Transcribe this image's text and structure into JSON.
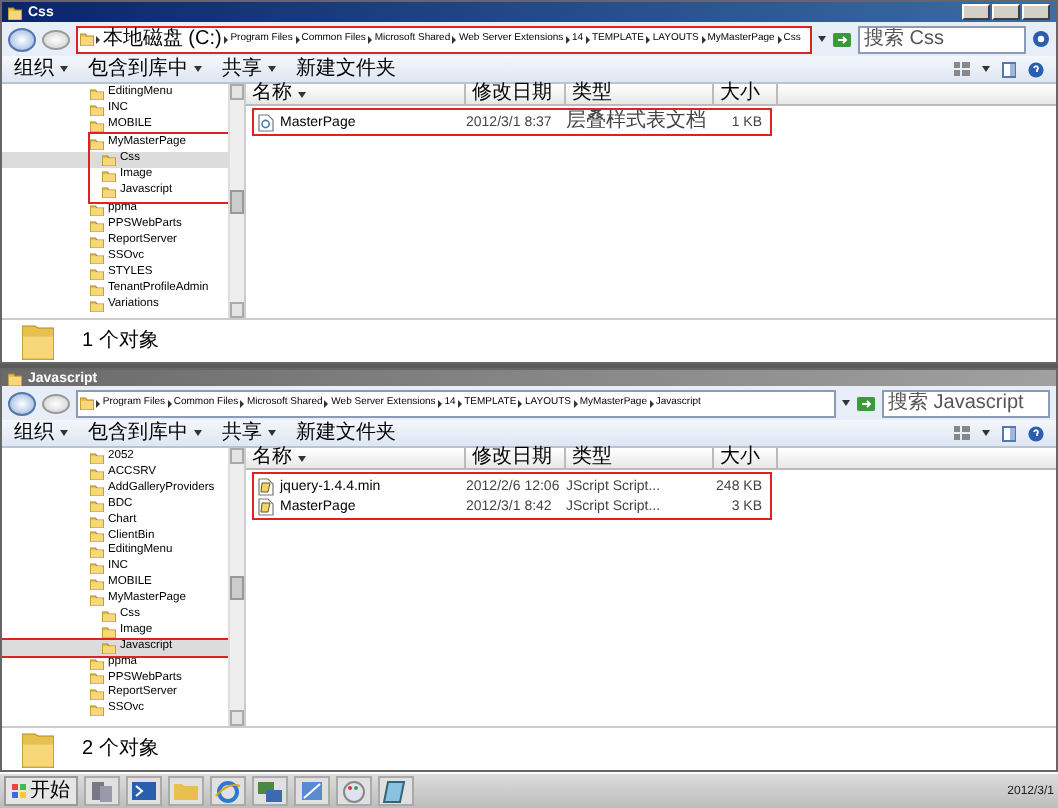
{
  "windows": [
    {
      "title": "Css",
      "caption_buttons": true,
      "address": {
        "highlighted": true,
        "crumbs": [
          "本地磁盘 (C:)",
          "Program Files",
          "Common Files",
          "Microsoft Shared",
          "Web Server Extensions",
          "14",
          "TEMPLATE",
          "LAYOUTS",
          "MyMasterPage",
          "Css"
        ]
      },
      "search": {
        "placeholder": "搜索 Css"
      },
      "toolbar": [
        {
          "label": "组织",
          "dropdown": true
        },
        {
          "label": "包含到库中",
          "dropdown": true
        },
        {
          "label": "共享",
          "dropdown": true
        },
        {
          "label": "新建文件夹",
          "dropdown": false
        }
      ],
      "tree": [
        {
          "label": "EditingMenu",
          "selected": false,
          "highlighted": false
        },
        {
          "label": "INC",
          "selected": false,
          "highlighted": false
        },
        {
          "label": "MOBILE",
          "selected": false,
          "highlighted": false
        },
        {
          "label": "MyMasterPage",
          "selected": false,
          "highlighted": true,
          "children": [
            {
              "label": "Css",
              "selected": true,
              "highlighted": false
            },
            {
              "label": "Image",
              "selected": false,
              "highlighted": false
            },
            {
              "label": "Javascript",
              "selected": false,
              "highlighted": false
            }
          ]
        },
        {
          "label": "ppma",
          "selected": false,
          "highlighted": false
        },
        {
          "label": "PPSWebParts",
          "selected": false,
          "highlighted": false
        },
        {
          "label": "ReportServer",
          "selected": false,
          "highlighted": false
        },
        {
          "label": "SSOvc",
          "selected": false,
          "highlighted": false
        },
        {
          "label": "STYLES",
          "selected": false,
          "highlighted": false
        },
        {
          "label": "TenantProfileAdmin",
          "selected": false,
          "highlighted": false
        },
        {
          "label": "Variations",
          "selected": false,
          "highlighted": false
        }
      ],
      "columns": [
        "名称",
        "修改日期",
        "类型",
        "大小"
      ],
      "files": {
        "highlighted": true,
        "rows": [
          {
            "kind": "css",
            "name": "MasterPage",
            "modified": "2012/3/1 8:37",
            "type": "层叠样式表文档",
            "size": "1 KB"
          }
        ]
      },
      "status": "1 个对象"
    },
    {
      "title": "Javascript",
      "caption_buttons": false,
      "address": {
        "highlighted": false,
        "crumbs": [
          "Program Files",
          "Common Files",
          "Microsoft Shared",
          "Web Server Extensions",
          "14",
          "TEMPLATE",
          "LAYOUTS",
          "MyMasterPage",
          "Javascript"
        ]
      },
      "search": {
        "placeholder": "搜索 Javascript"
      },
      "toolbar": [
        {
          "label": "组织",
          "dropdown": true
        },
        {
          "label": "包含到库中",
          "dropdown": true
        },
        {
          "label": "共享",
          "dropdown": true
        },
        {
          "label": "新建文件夹",
          "dropdown": false
        }
      ],
      "tree": [
        {
          "label": "2052",
          "selected": false,
          "highlighted": false
        },
        {
          "label": "ACCSRV",
          "selected": false,
          "highlighted": false
        },
        {
          "label": "AddGalleryProviders",
          "selected": false,
          "highlighted": false
        },
        {
          "label": "BDC",
          "selected": false,
          "highlighted": false
        },
        {
          "label": "Chart",
          "selected": false,
          "highlighted": false
        },
        {
          "label": "ClientBin",
          "selected": false,
          "highlighted": false
        },
        {
          "label": "EditingMenu",
          "selected": false,
          "highlighted": false
        },
        {
          "label": "INC",
          "selected": false,
          "highlighted": false
        },
        {
          "label": "MOBILE",
          "selected": false,
          "highlighted": false
        },
        {
          "label": "MyMasterPage",
          "selected": false,
          "highlighted": false,
          "children": [
            {
              "label": "Css",
              "selected": false,
              "highlighted": false
            },
            {
              "label": "Image",
              "selected": false,
              "highlighted": false
            },
            {
              "label": "Javascript",
              "selected": true,
              "highlighted": true
            }
          ]
        },
        {
          "label": "ppma",
          "selected": false,
          "highlighted": false
        },
        {
          "label": "PPSWebParts",
          "selected": false,
          "highlighted": false
        },
        {
          "label": "ReportServer",
          "selected": false,
          "highlighted": false
        },
        {
          "label": "SSOvc",
          "selected": false,
          "highlighted": false
        }
      ],
      "columns": [
        "名称",
        "修改日期",
        "类型",
        "大小"
      ],
      "files": {
        "highlighted": true,
        "rows": [
          {
            "kind": "js",
            "name": "jquery-1.4.4.min",
            "modified": "2012/2/6 12:06",
            "type": "JScript Script...",
            "size": "248 KB"
          },
          {
            "kind": "js",
            "name": "MasterPage",
            "modified": "2012/3/1 8:42",
            "type": "JScript Script...",
            "size": "3 KB"
          }
        ]
      },
      "status": "2 个对象"
    }
  ],
  "taskbar": {
    "start": "开始",
    "clock": "2012/3/1"
  }
}
